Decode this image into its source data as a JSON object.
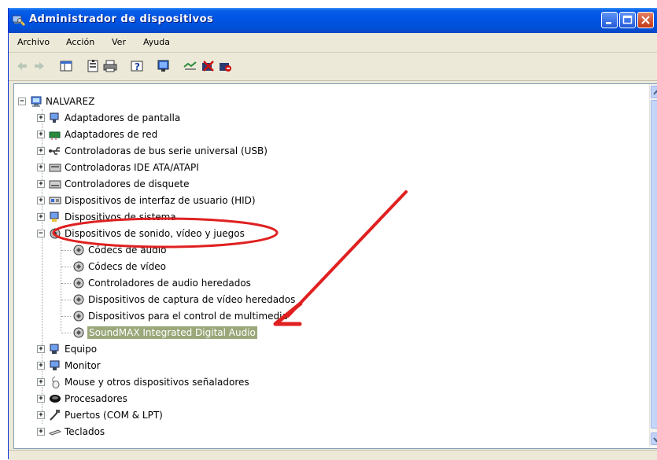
{
  "window": {
    "title": "Administrador de dispositivos",
    "controls": [
      "minimize-icon",
      "maximize-icon",
      "close-icon"
    ]
  },
  "menu": [
    "Archivo",
    "Acción",
    "Ver",
    "Ayuda"
  ],
  "toolbar": [
    "back-arrow-icon",
    "forward-arrow-icon",
    "console-tree-icon",
    "properties-icon",
    "print-icon",
    "help-icon",
    "scan-hardware-icon",
    "update-driver-icon",
    "uninstall-icon",
    "disable-icon"
  ],
  "tree": {
    "root": "NALVAREZ",
    "categories": [
      {
        "label": "Adaptadores de pantalla",
        "icon": "display-adapter-icon"
      },
      {
        "label": "Adaptadores de red",
        "icon": "network-adapter-icon"
      },
      {
        "label": "Controladoras de bus serie universal (USB)",
        "icon": "usb-icon"
      },
      {
        "label": "Controladoras IDE ATA/ATAPI",
        "icon": "ide-controller-icon"
      },
      {
        "label": "Controladores de disquete",
        "icon": "floppy-controller-icon"
      },
      {
        "label": "Dispositivos de interfaz de usuario (HID)",
        "icon": "hid-icon"
      },
      {
        "label": "Dispositivos de sistema",
        "icon": "system-devices-icon"
      },
      {
        "label": "Dispositivos de sonido, vídeo y juegos",
        "icon": "sound-video-icon",
        "expanded": true,
        "children": [
          "Códecs de audio",
          "Códecs de vídeo",
          "Controladores de audio heredados",
          "Dispositivos de captura de vídeo heredados",
          "Dispositivos para el control de multimedia",
          "SoundMAX Integrated Digital Audio"
        ],
        "selected_child": "SoundMAX Integrated Digital Audio"
      },
      {
        "label": "Equipo",
        "icon": "computer-icon"
      },
      {
        "label": "Monitor",
        "icon": "monitor-icon"
      },
      {
        "label": "Mouse y otros dispositivos señaladores",
        "icon": "mouse-icon"
      },
      {
        "label": "Procesadores",
        "icon": "processor-icon"
      },
      {
        "label": "Puertos (COM & LPT)",
        "icon": "ports-icon"
      },
      {
        "label": "Teclados",
        "icon": "keyboard-icon"
      }
    ]
  },
  "colors": {
    "titlebar": "#0055e5",
    "selection": "#9aa87a",
    "annotation_red": "#e02020"
  }
}
